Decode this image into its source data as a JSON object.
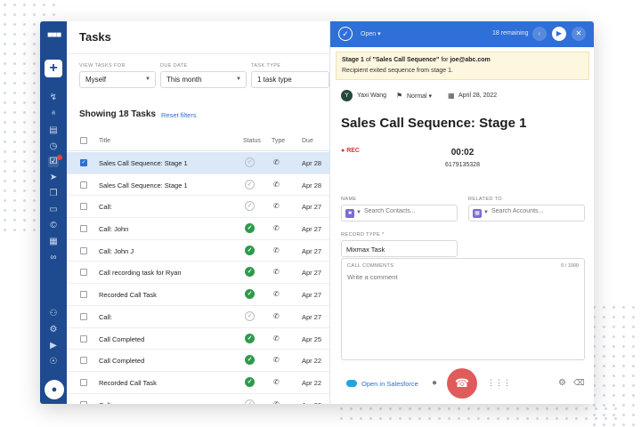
{
  "main": {
    "title": "Tasks",
    "filters": [
      {
        "label": "VIEW TASKS FOR",
        "value": "Myself"
      },
      {
        "label": "DUE DATE",
        "value": "This month"
      },
      {
        "label": "TASK TYPE",
        "value": "1 task type"
      }
    ],
    "showing": "Showing 18 Tasks",
    "reset_filters": "Reset filters",
    "columns": {
      "title": "Title",
      "status": "Status",
      "type": "Type",
      "due": "Due"
    },
    "rows": [
      {
        "title": "Sales Call Sequence: Stage 1",
        "status": "open",
        "due": "Apr 28",
        "selected": true
      },
      {
        "title": "Sales Call Sequence: Stage 1",
        "status": "open",
        "due": "Apr 28",
        "selected": false
      },
      {
        "title": "Call:",
        "status": "open",
        "due": "Apr 27",
        "selected": false
      },
      {
        "title": "Call: John",
        "status": "done",
        "due": "Apr 27",
        "selected": false
      },
      {
        "title": "Call: John J",
        "status": "done",
        "due": "Apr 27",
        "selected": false
      },
      {
        "title": "Call recording task for Ryan",
        "status": "done",
        "due": "Apr 27",
        "selected": false
      },
      {
        "title": "Recorded Call Task",
        "status": "done",
        "due": "Apr 27",
        "selected": false
      },
      {
        "title": "Call:",
        "status": "open",
        "due": "Apr 27",
        "selected": false
      },
      {
        "title": "Call Completed",
        "status": "done",
        "due": "Apr 25",
        "selected": false
      },
      {
        "title": "Call Completed",
        "status": "done",
        "due": "Apr 22",
        "selected": false
      },
      {
        "title": "Recorded Call Task",
        "status": "done",
        "due": "Apr 22",
        "selected": false
      },
      {
        "title": "Call:",
        "status": "open",
        "due": "Apr 22",
        "selected": false
      }
    ]
  },
  "panel": {
    "status": "Open",
    "remaining": "18 remaining",
    "notice_pre": "Stage 1",
    "notice_mid": " of ",
    "notice_seq": "\"Sales Call Sequence\"",
    "notice_for": " for ",
    "notice_email": "joe@abc.com",
    "notice_line2": "Recipient exited sequence from stage 1.",
    "avatar_letter": "Y",
    "assignee": "Yaxi Wang",
    "priority": "Normal",
    "date": "April 28, 2022",
    "title": "Sales Call Sequence: Stage 1",
    "rec": "REC",
    "timer": "00:02",
    "phone": "6179135328",
    "name_label": "NAME",
    "name_placeholder": "Search Contacts...",
    "related_label": "RELATED TO",
    "related_placeholder": "Search Accounts...",
    "record_type_label": "RECORD TYPE *",
    "record_type_value": "Mixmax Task",
    "comments_label": "CALL COMMENTS",
    "comments_count": "0 / 1000",
    "comments_placeholder": "Write a comment",
    "salesforce_link": "Open in Salesforce"
  },
  "colors": {
    "sidebar": "#1e4b8f",
    "header": "#2f6fd8",
    "link": "#2a6fd6",
    "done": "#2e9a4c",
    "hangup": "#e05b5b",
    "selected_row": "#dbe8f8"
  }
}
